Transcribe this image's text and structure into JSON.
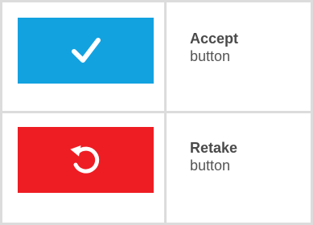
{
  "colors": {
    "accept_bg": "#13a2e0",
    "retake_bg": "#ee1d23",
    "icon": "#ffffff",
    "grid_line": "#dcdcdc",
    "text": "#4a4a4a"
  },
  "rows": [
    {
      "icon": "checkmark-icon",
      "name": "Accept",
      "kind": "button"
    },
    {
      "icon": "undo-icon",
      "name": "Retake",
      "kind": "button"
    }
  ]
}
